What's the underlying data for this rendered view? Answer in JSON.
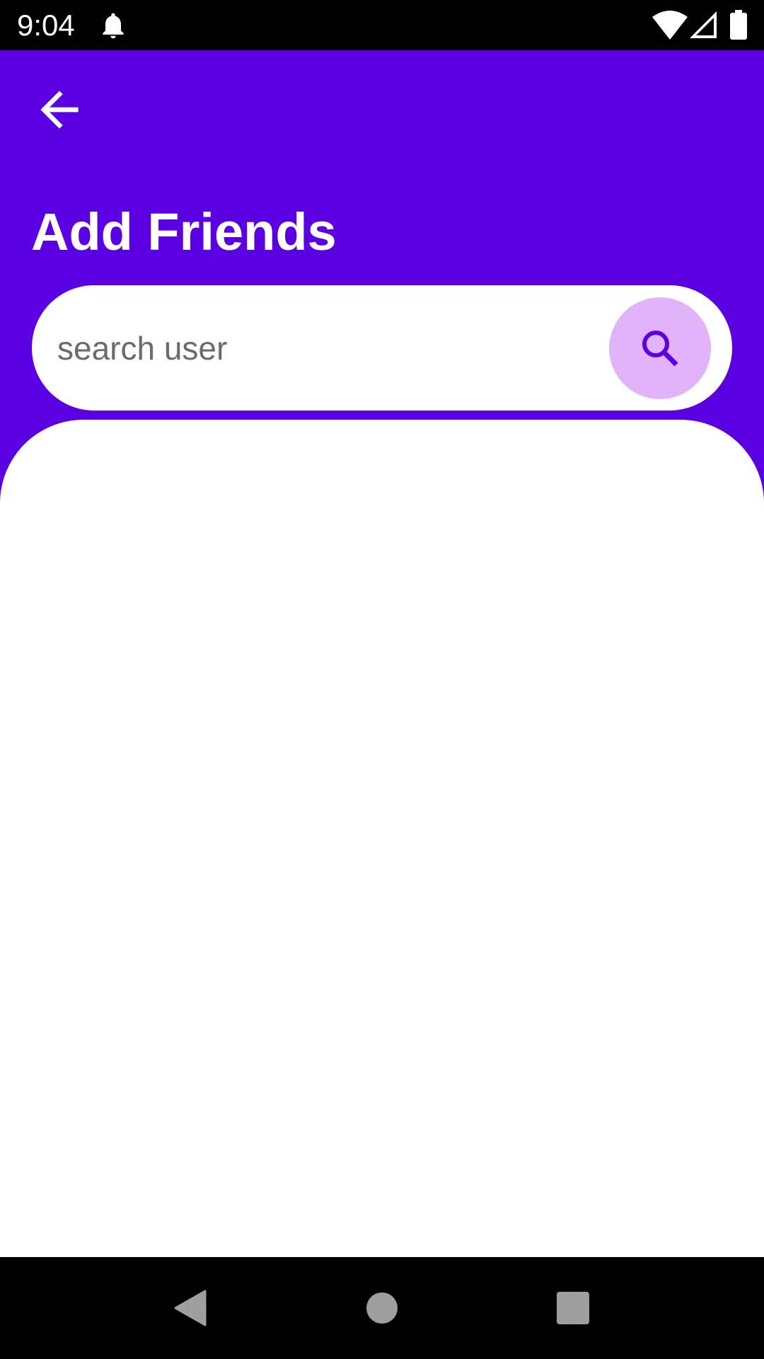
{
  "status_bar": {
    "time": "9:04",
    "icons": [
      "notification-bell-icon",
      "wifi-icon",
      "cell-signal-icon",
      "battery-icon"
    ]
  },
  "app_bar": {
    "back_icon": "arrow-back-icon",
    "title": "Add Friends"
  },
  "search": {
    "placeholder": "search user",
    "value": "",
    "button_icon": "search-icon"
  },
  "nav_bar": {
    "buttons": [
      "back-triangle-icon",
      "home-circle-icon",
      "recents-square-icon"
    ]
  },
  "colors": {
    "primary": "#5B00E2",
    "search_button_bg": "#E1B3F8",
    "search_icon": "#5B00E2",
    "surface": "#FFFFFF",
    "system_bars": "#000000",
    "nav_icons": "#9E9E9E"
  }
}
